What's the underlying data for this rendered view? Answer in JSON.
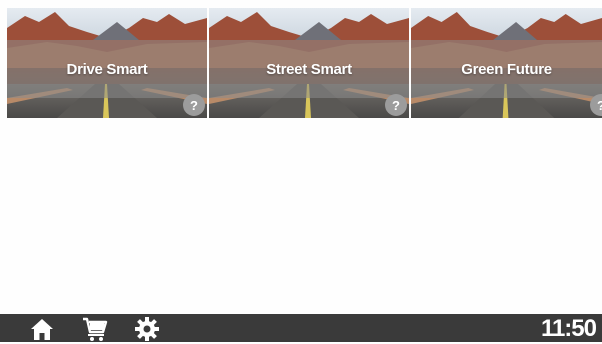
{
  "tiles": [
    {
      "title": "Drive Smart",
      "help_label": "?"
    },
    {
      "title": "Street Smart",
      "help_label": "?"
    },
    {
      "title": "Green Future",
      "help_label": "?"
    }
  ],
  "bottom_bar": {
    "icons": [
      "home-icon",
      "cart-icon",
      "gear-icon"
    ],
    "clock": "11:50"
  },
  "colors": {
    "bar": "#3a3a3a",
    "banner_overlay": "#8c8c8c",
    "help_badge": "#9c9c9c",
    "text": "#ffffff"
  }
}
